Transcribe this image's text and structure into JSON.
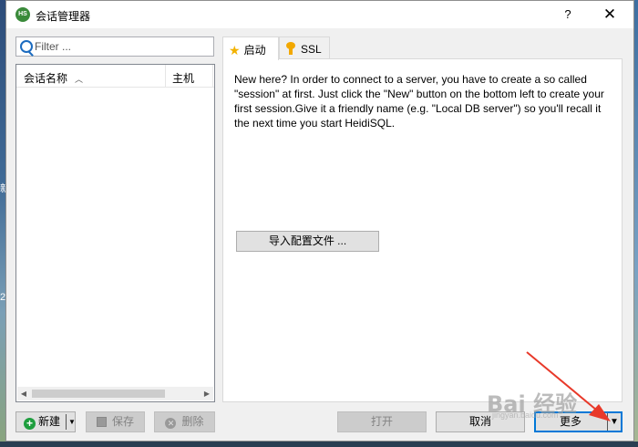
{
  "window": {
    "title": "会话管理器",
    "app_icon_text": "HS",
    "help_label": "?",
    "close_label": "✕"
  },
  "filter": {
    "placeholder": "Filter ..."
  },
  "session_list": {
    "columns": [
      {
        "label": "会话名称",
        "sort": "ascending"
      },
      {
        "label": "主机"
      }
    ]
  },
  "tabs": [
    {
      "label": "启动",
      "icon": "star-icon",
      "active": true
    },
    {
      "label": "SSL",
      "icon": "key-icon",
      "active": false
    }
  ],
  "start_panel": {
    "intro_text": "New here? In order to connect to a server, you have to create a so called \"session\" at first. Just click the \"New\" button on the bottom left to create your first session.Give it a friendly name (e.g. \"Local DB server\") so you'll recall it the next time you start HeidiSQL.",
    "import_label": "导入配置文件 ..."
  },
  "footer": {
    "new_label": "新建",
    "save_label": "保存",
    "delete_label": "删除",
    "open_label": "打开",
    "cancel_label": "取消",
    "more_label": "更多"
  },
  "desktop": {
    "left_chars": [
      "新",
      "2"
    ]
  },
  "watermark": {
    "main": "Bai 经验",
    "sub": "jingyan.baidu.com"
  },
  "colors": {
    "accent": "#0078d7",
    "annotation_arrow": "#e8392a"
  }
}
